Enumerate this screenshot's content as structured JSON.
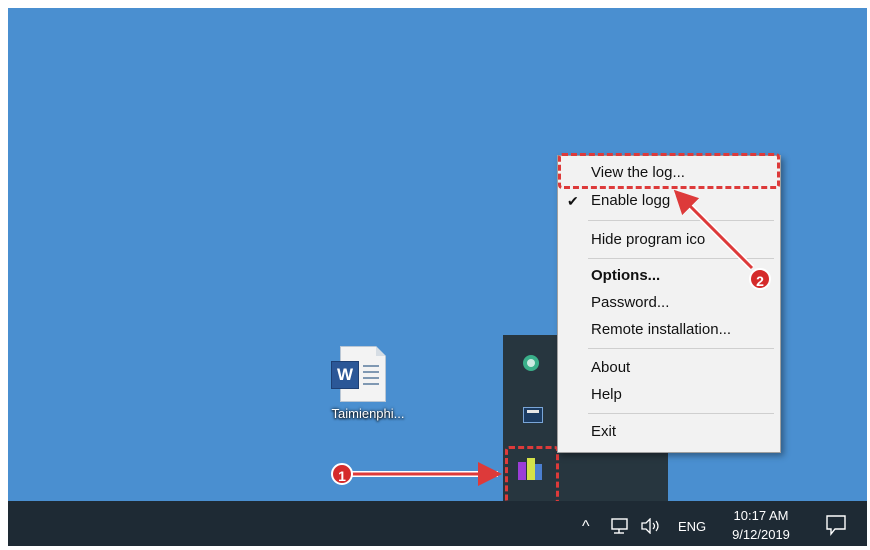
{
  "desktop": {
    "icon_label": "Taimienphi...",
    "icon_badge": "W"
  },
  "context_menu": {
    "items": [
      {
        "label": "View the log...",
        "bold": false,
        "checked": false
      },
      {
        "label": "Enable logg",
        "bold": false,
        "checked": true
      },
      {
        "label": "Hide program ico",
        "bold": false,
        "checked": false
      },
      {
        "label": "Options...",
        "bold": true,
        "checked": false
      },
      {
        "label": "Password...",
        "bold": false,
        "checked": false
      },
      {
        "label": "Remote installation...",
        "bold": false,
        "checked": false
      },
      {
        "label": "About",
        "bold": false,
        "checked": false
      },
      {
        "label": "Help",
        "bold": false,
        "checked": false
      },
      {
        "label": "Exit",
        "bold": false,
        "checked": false
      }
    ],
    "check_glyph": "✔"
  },
  "annotations": {
    "step1": "1",
    "step2": "2",
    "color": "#dd3a3a"
  },
  "taskbar": {
    "chevron": "^",
    "language": "ENG",
    "time": "10:17 AM",
    "date": "9/12/2019",
    "background": "#1e2a34"
  },
  "tray_icons": [
    "green-circle-icon",
    "monitor-icon",
    "app-bars-icon"
  ],
  "colors": {
    "desktop": "#4a8fd0",
    "menu_bg": "#f2f2f2"
  }
}
